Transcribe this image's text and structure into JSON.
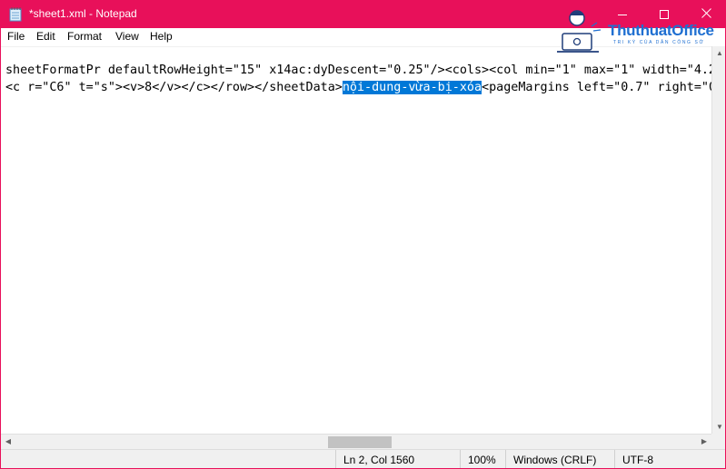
{
  "window": {
    "title": "*sheet1.xml - Notepad"
  },
  "menu": {
    "file": "File",
    "edit": "Edit",
    "format": "Format",
    "view": "View",
    "help": "Help"
  },
  "logo": {
    "name": "ThuthuatOffice",
    "tagline": "TRI KỲ CỦA DÂN CÔNG SỞ"
  },
  "editor": {
    "line1": "sheetFormatPr defaultRowHeight=\"15\" x14ac:dyDescent=\"0.25\"/><cols><col min=\"1\" max=\"1\" width=\"4.2",
    "line2_before": "<c r=\"C6\" t=\"s\"><v>8</v></c></row></sheetData>",
    "line2_selected": "nội-dung-vừa-bị-xóa",
    "line2_after": "<pageMargins left=\"0.7\" right=\"0"
  },
  "status": {
    "position": "Ln 2, Col 1560",
    "zoom": "100%",
    "line_ending": "Windows (CRLF)",
    "encoding": "UTF-8"
  },
  "colors": {
    "titlebar": "#e8105a",
    "selection": "#0078d7",
    "logo_blue": "#1f6fd1"
  },
  "icons": {
    "app": "notepad-icon",
    "minimize": "minimize-icon",
    "maximize": "maximize-icon",
    "close": "close-icon"
  }
}
